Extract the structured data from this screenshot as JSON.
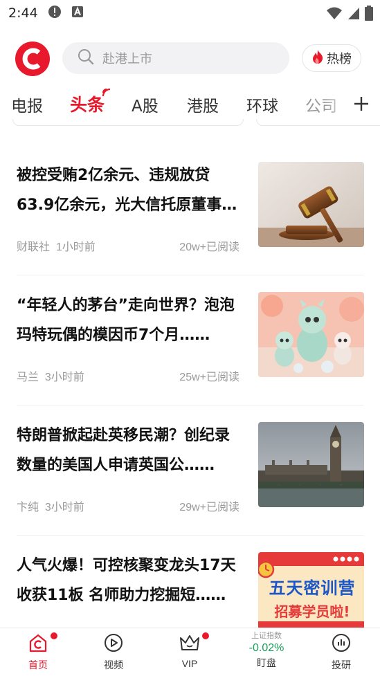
{
  "status_bar": {
    "time": "2:44"
  },
  "header": {
    "search_placeholder": "赴港上市",
    "hot_label": "热榜"
  },
  "tabs": [
    "电报",
    "头条",
    "A股",
    "港股",
    "环球",
    "公司"
  ],
  "active_tab": "头条",
  "feed": [
    {
      "title": "被控受贿2亿余元、违规放贷63.9亿余元，光大信托原董事长……",
      "source": "财联社",
      "time": "1小时前",
      "reads": "20w+已阅读",
      "image": "gavel"
    },
    {
      "title": "“年轻人的茅台”走向世界？泡泡玛特玩偶的模因币7个月……",
      "source": "马兰",
      "time": "3小时前",
      "reads": "25w+已阅读",
      "image": "toys"
    },
    {
      "title": "特朗普掀起赴英移民潮？创纪录数量的美国人申请英国公……",
      "source": "卞纯",
      "time": "3小时前",
      "reads": "29w+已阅读",
      "image": "big-ben"
    },
    {
      "title": "人气火爆！可控核聚变龙头17天收获11板 名师助力挖掘短……",
      "source": "",
      "time": "",
      "reads": "",
      "image": "promo-banner",
      "image_text_line1": "五天密训营",
      "image_text_line2": "招募学员啦!"
    }
  ],
  "bottom_nav": {
    "home": "首页",
    "video": "视频",
    "vip": "VIP",
    "market_index_name": "上证指数",
    "market_index_value": "-0.02%",
    "market": "盯盘",
    "research": "投研"
  },
  "colors": {
    "brand_red": "#e8192c",
    "index_green": "#18a058"
  }
}
